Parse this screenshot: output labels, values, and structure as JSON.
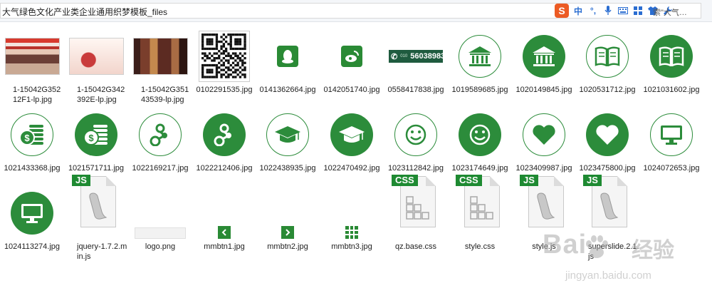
{
  "address_bar": {
    "path": "大气绿色文化产业类企业通用织梦模板_files",
    "search_snippet": "索\"大气…"
  },
  "ime_toolbar": {
    "logo": "S",
    "items": [
      {
        "name": "lang-toggle",
        "text": "中"
      },
      {
        "name": "punctuation",
        "text": "°,"
      },
      {
        "name": "mic",
        "icon": "microphone-icon"
      },
      {
        "name": "keyboard",
        "icon": "keyboard-icon"
      },
      {
        "name": "toolbox",
        "icon": "grid-icon"
      },
      {
        "name": "skin",
        "icon": "shirt-icon"
      },
      {
        "name": "settings",
        "icon": "wrench-icon"
      }
    ]
  },
  "files": [
    {
      "name": "1-15042G35212F1-lp.jpg",
      "kind": "photo-1"
    },
    {
      "name": "1-15042G342392E-lp.jpg",
      "kind": "photo-2"
    },
    {
      "name": "1-15042G35143539-lp.jpg",
      "kind": "photo-3"
    },
    {
      "name": "0102291535.jpg",
      "kind": "qr-code"
    },
    {
      "name": "0141362664.jpg",
      "kind": "qq-square"
    },
    {
      "name": "0142051740.jpg",
      "kind": "weibo-square"
    },
    {
      "name": "0558417838.jpg",
      "kind": "phone-banner",
      "banner_text": "56038983",
      "banner_prefix": "010"
    },
    {
      "name": "1019589685.jpg",
      "kind": "bank-outline"
    },
    {
      "name": "1020149845.jpg",
      "kind": "bank-filled"
    },
    {
      "name": "1020531712.jpg",
      "kind": "book-outline"
    },
    {
      "name": "1021031602.jpg",
      "kind": "book-filled"
    },
    {
      "name": "1021433368.jpg",
      "kind": "coins-outline"
    },
    {
      "name": "1021571711.jpg",
      "kind": "coins-filled"
    },
    {
      "name": "1022169217.jpg",
      "kind": "molecule-outline"
    },
    {
      "name": "1022212406.jpg",
      "kind": "molecule-filled"
    },
    {
      "name": "1022438935.jpg",
      "kind": "grad-cap-outline"
    },
    {
      "name": "1022470492.jpg",
      "kind": "grad-cap-filled"
    },
    {
      "name": "1023112842.jpg",
      "kind": "smiley-outline"
    },
    {
      "name": "1023174649.jpg",
      "kind": "smiley-filled"
    },
    {
      "name": "1023409987.jpg",
      "kind": "heart-outline"
    },
    {
      "name": "1023475800.jpg",
      "kind": "heart-filled"
    },
    {
      "name": "1024072653.jpg",
      "kind": "monitor-outline"
    },
    {
      "name": "1024113274.jpg",
      "kind": "monitor-filled"
    },
    {
      "name": "jquery-1.7.2.min.js",
      "kind": "js-file",
      "tag": "JS"
    },
    {
      "name": "logo.png",
      "kind": "logo"
    },
    {
      "name": "mmbtn1.jpg",
      "kind": "arrow-left"
    },
    {
      "name": "mmbtn2.jpg",
      "kind": "arrow-right"
    },
    {
      "name": "mmbtn3.jpg",
      "kind": "grid"
    },
    {
      "name": "qz.base.css",
      "kind": "css-file",
      "tag": "CSS"
    },
    {
      "name": "style.css",
      "kind": "css-file",
      "tag": "CSS"
    },
    {
      "name": "style.js",
      "kind": "js-file",
      "tag": "JS"
    },
    {
      "name": "superslide.2.1.js",
      "kind": "js-file",
      "tag": "JS"
    }
  ],
  "watermark": {
    "brand": "Bai",
    "brand_tail": "经验",
    "url": "jingyan.baidu.com"
  }
}
